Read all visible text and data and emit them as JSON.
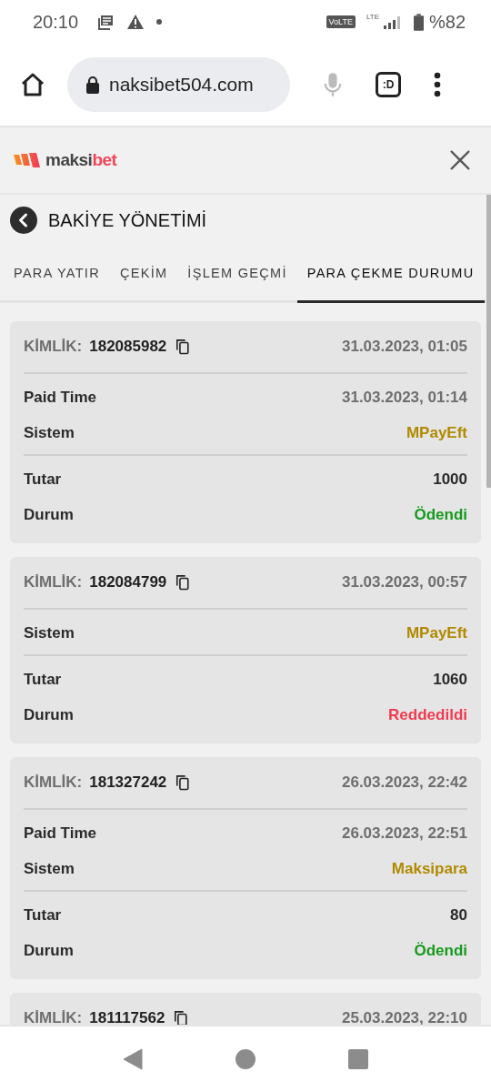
{
  "status_bar": {
    "time": "20:10",
    "network_badge": "VoLTE",
    "network_type": "LTE",
    "battery": "%82"
  },
  "browser": {
    "url": "naksibet504.com",
    "tab_switcher": ":D"
  },
  "site_header": {
    "logo": {
      "prefix": "maksi",
      "suffix": "bet"
    }
  },
  "page": {
    "title": "BAKİYE YÖNETİMİ"
  },
  "tabs": [
    {
      "label": "PARA YATIR",
      "selected": false
    },
    {
      "label": "ÇEKİM",
      "selected": false
    },
    {
      "label": "İŞLEM GEÇMİ",
      "selected": false
    },
    {
      "label": "PARA ÇEKME DURUMU",
      "selected": true
    }
  ],
  "withdrawals": [
    {
      "id_label": "KİMLİK:",
      "id": "182085982",
      "date": "31.03.2023, 01:05",
      "groups": [
        [
          {
            "label": "Paid Time",
            "value": "31.03.2023, 01:14",
            "kind": "time"
          },
          {
            "label": "Sistem",
            "value": "MPayEft",
            "kind": "system"
          }
        ],
        [
          {
            "label": "Tutar",
            "value": "1000",
            "kind": "amount"
          },
          {
            "label": "Durum",
            "value": "Ödendi",
            "kind": "paid"
          }
        ]
      ]
    },
    {
      "id_label": "KİMLİK:",
      "id": "182084799",
      "date": "31.03.2023, 00:57",
      "groups": [
        [
          {
            "label": "Sistem",
            "value": "MPayEft",
            "kind": "system"
          }
        ],
        [
          {
            "label": "Tutar",
            "value": "1060",
            "kind": "amount"
          },
          {
            "label": "Durum",
            "value": "Reddedildi",
            "kind": "rejected"
          }
        ]
      ]
    },
    {
      "id_label": "KİMLİK:",
      "id": "181327242",
      "date": "26.03.2023, 22:42",
      "groups": [
        [
          {
            "label": "Paid Time",
            "value": "26.03.2023, 22:51",
            "kind": "time"
          },
          {
            "label": "Sistem",
            "value": "Maksipara",
            "kind": "system"
          }
        ],
        [
          {
            "label": "Tutar",
            "value": "80",
            "kind": "amount"
          },
          {
            "label": "Durum",
            "value": "Ödendi",
            "kind": "paid"
          }
        ]
      ]
    },
    {
      "id_label": "KİMLİK:",
      "id": "181117562",
      "date": "25.03.2023, 22:10"
    }
  ]
}
